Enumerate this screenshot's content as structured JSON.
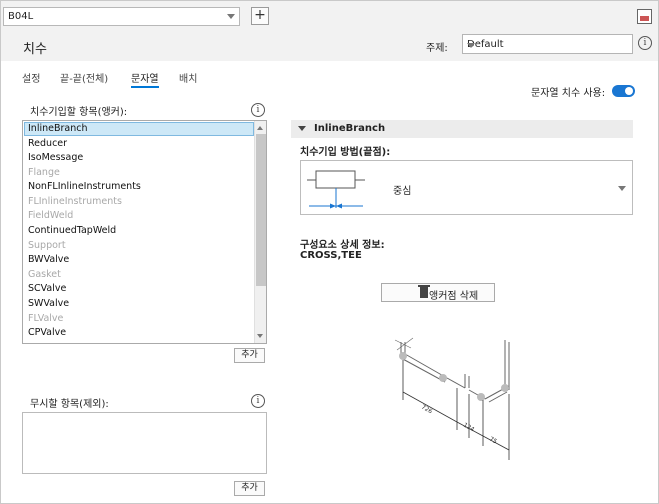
{
  "toolbar": {
    "combo_value": "B04L",
    "add_label": "+"
  },
  "header": {
    "title": "치수",
    "theme_label": "주제:",
    "theme_value": "Default",
    "info_glyph": "i"
  },
  "tabs": [
    {
      "label": "설정",
      "active": false
    },
    {
      "label": "끝-끝(전체)",
      "active": false
    },
    {
      "label": "문자열",
      "active": true
    },
    {
      "label": "배치",
      "active": false
    }
  ],
  "toggle": {
    "label": "문자열 치수 사용:",
    "on": true
  },
  "left": {
    "anchor_label": "치수기입할 항목(앵커):",
    "items": [
      {
        "label": "InlineBranch",
        "state": "selected"
      },
      {
        "label": "Reducer",
        "state": "normal"
      },
      {
        "label": "IsoMessage",
        "state": "normal"
      },
      {
        "label": "Flange",
        "state": "disabled"
      },
      {
        "label": "NonFLInlineInstruments",
        "state": "normal"
      },
      {
        "label": "FLInlineInstruments",
        "state": "disabled"
      },
      {
        "label": "FieldWeld",
        "state": "disabled"
      },
      {
        "label": "ContinuedTapWeld",
        "state": "normal"
      },
      {
        "label": "Support",
        "state": "disabled"
      },
      {
        "label": "BWValve",
        "state": "normal"
      },
      {
        "label": "Gasket",
        "state": "disabled"
      },
      {
        "label": "SCValve",
        "state": "normal"
      },
      {
        "label": "SWValve",
        "state": "normal"
      },
      {
        "label": "FLValve",
        "state": "disabled"
      },
      {
        "label": "CPValve",
        "state": "normal"
      }
    ],
    "add_button": "추가",
    "ignore_label": "무시할 항목(제외):",
    "ignore_add_button": "추가"
  },
  "right": {
    "section_title": "InlineBranch",
    "method_label": "치수기입 방법(끝점):",
    "method_value": "중심",
    "detail_label": "구성요소 상세 정보:",
    "detail_value": "CROSS,TEE",
    "delete_anchor_button": "앵커점 삭제",
    "diagram_dims": [
      "726",
      "124",
      "75"
    ]
  },
  "colors": {
    "accent": "#0078d7",
    "toggle_on": "#1976d2",
    "selected_row": "#cde8f7"
  }
}
